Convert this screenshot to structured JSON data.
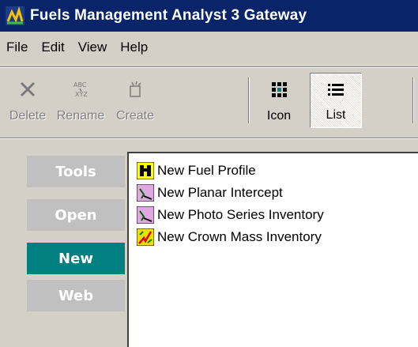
{
  "window": {
    "title": "Fuels Management Analyst 3 Gateway",
    "icon": "fma-app-icon"
  },
  "menubar": {
    "items": [
      "File",
      "Edit",
      "View",
      "Help"
    ]
  },
  "toolbar": {
    "buttons": [
      {
        "label": "Delete",
        "icon": "x-delete-icon",
        "enabled": false
      },
      {
        "label": "Rename",
        "icon": "rename-abc-icon",
        "enabled": false
      },
      {
        "label": "Create",
        "icon": "create-spark-icon",
        "enabled": false
      },
      {
        "label": "Icon",
        "icon": "large-icons-view-icon",
        "enabled": true
      },
      {
        "label": "List",
        "icon": "list-view-icon",
        "enabled": true,
        "pressed": true
      }
    ]
  },
  "nav": {
    "items": [
      {
        "label": "Tools",
        "active": false
      },
      {
        "label": "Open",
        "active": false
      },
      {
        "label": "New",
        "active": true
      },
      {
        "label": "Web",
        "active": false
      }
    ],
    "active_color": "#008080",
    "inactive_color": "#c0c0c0"
  },
  "list": {
    "items": [
      {
        "label": "New Fuel Profile",
        "icon": "binoculars-icon"
      },
      {
        "label": "New Planar Intercept",
        "icon": "planar-intercept-icon"
      },
      {
        "label": "New Photo Series Inventory",
        "icon": "photo-series-icon"
      },
      {
        "label": "New Crown Mass Inventory",
        "icon": "crown-mass-icon"
      }
    ]
  }
}
